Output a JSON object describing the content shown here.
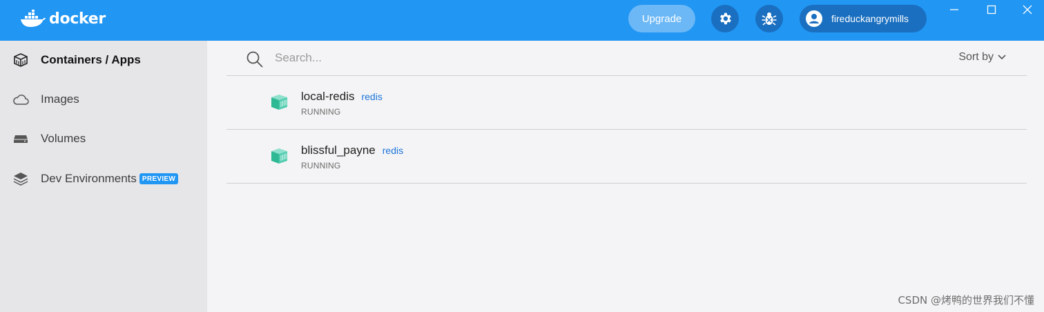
{
  "header": {
    "brand": "docker",
    "upgrade_label": "Upgrade",
    "username": "fireduckangrymills",
    "accent_color": "#2196f3",
    "icons": [
      "docker-whale-icon",
      "gear-icon",
      "bug-icon",
      "user-icon",
      "minimize-icon",
      "maximize-icon",
      "close-icon"
    ]
  },
  "sidebar": {
    "items": [
      {
        "label": "Containers / Apps",
        "icon": "container-cube-icon",
        "active": true
      },
      {
        "label": "Images",
        "icon": "cloud-icon",
        "active": false
      },
      {
        "label": "Volumes",
        "icon": "drive-icon",
        "active": false
      },
      {
        "label": "Dev Environments",
        "icon": "layers-icon",
        "active": false,
        "badge": "PREVIEW"
      }
    ]
  },
  "main": {
    "search": {
      "value": "",
      "placeholder": "Search..."
    },
    "sort_label": "Sort by",
    "containers": [
      {
        "name": "local-redis",
        "image": "redis",
        "status": "RUNNING"
      },
      {
        "name": "blissful_payne",
        "image": "redis",
        "status": "RUNNING"
      }
    ]
  },
  "watermark": "CSDN @烤鸭的世界我们不懂"
}
